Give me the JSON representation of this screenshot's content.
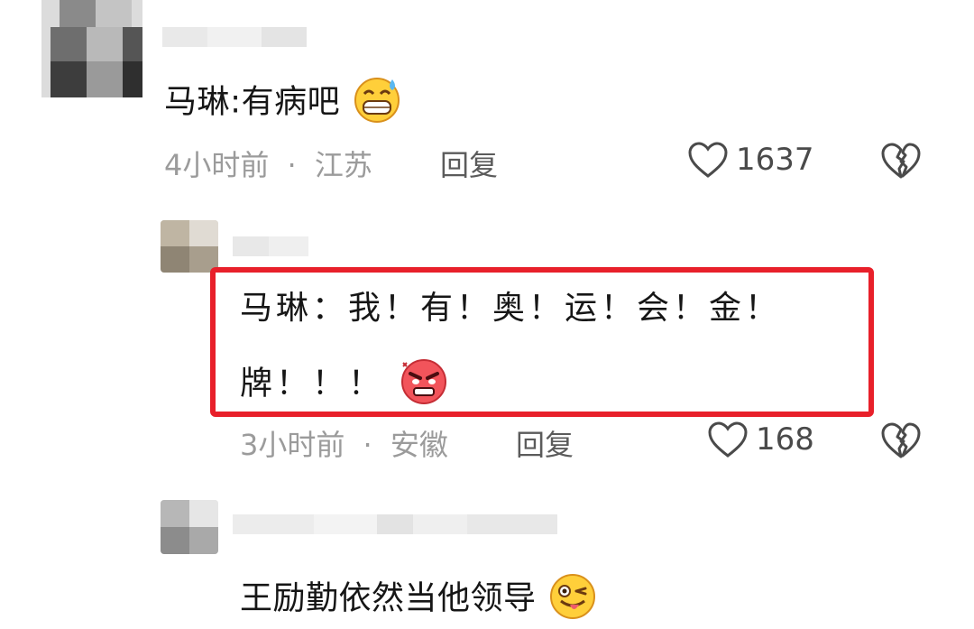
{
  "comments": [
    {
      "text": "马琳:有病吧",
      "emoji": "sweat-grin-emoji",
      "time": "4小时前",
      "separator": "·",
      "location": "江苏",
      "reply_label": "回复",
      "likes": "1637"
    },
    {
      "line1": "马琳：我！有！奥！运！会！金！",
      "line2": "牌！！！",
      "emoji": "angry-face-emoji",
      "time": "3小时前",
      "separator": "·",
      "location": "安徽",
      "reply_label": "回复",
      "likes": "168"
    },
    {
      "text": "王励勤依然当他领导",
      "emoji": "winking-tongue-emoji"
    }
  ],
  "colors": {
    "highlight": "#e8202a",
    "meta_text": "#9b9b9b",
    "body_text": "#161616"
  }
}
